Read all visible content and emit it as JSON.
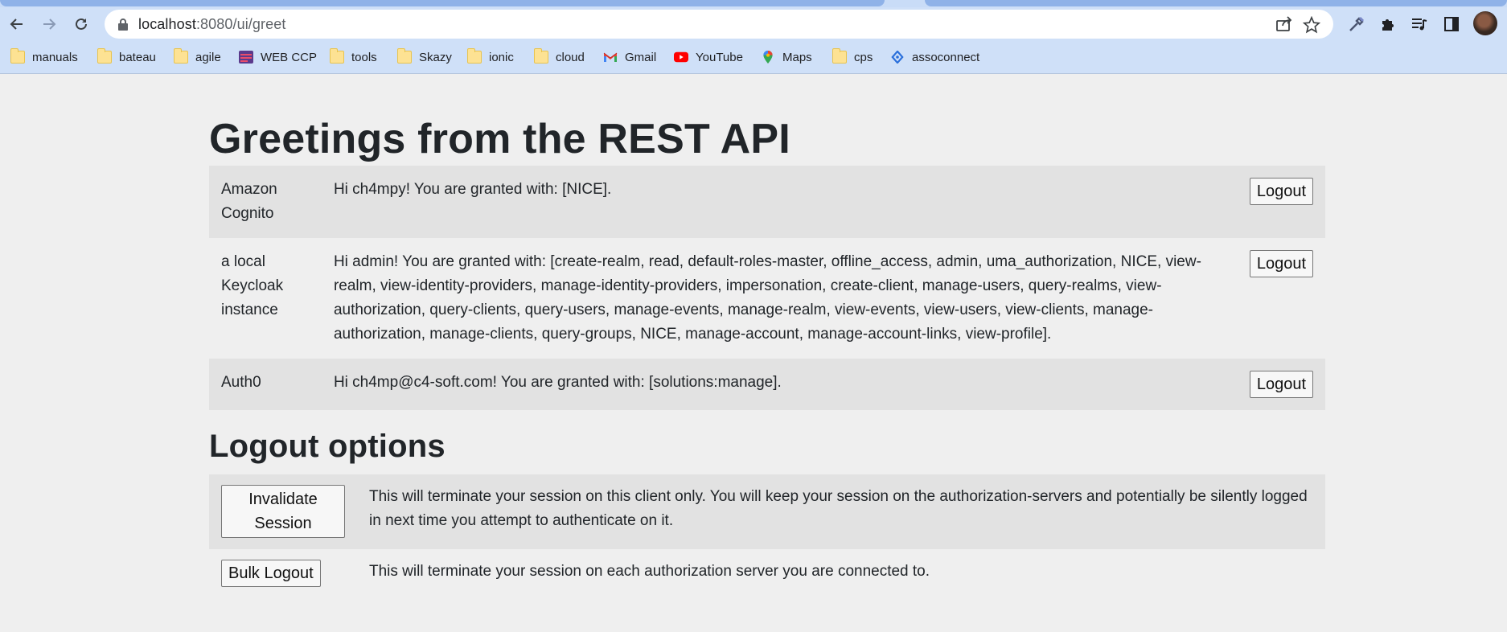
{
  "browser": {
    "url_host": "localhost",
    "url_rest": ":8080/ui/greet",
    "bookmarks": [
      {
        "label": "manuals",
        "icon": "folder-icon"
      },
      {
        "label": "bateau",
        "icon": "folder-icon"
      },
      {
        "label": "agile",
        "icon": "folder-icon"
      },
      {
        "label": "WEB CCP",
        "icon": "webccp-icon"
      },
      {
        "label": "tools",
        "icon": "folder-icon"
      },
      {
        "label": "Skazy",
        "icon": "folder-icon"
      },
      {
        "label": "ionic",
        "icon": "folder-icon"
      },
      {
        "label": "cloud",
        "icon": "folder-icon"
      },
      {
        "label": "Gmail",
        "icon": "gmail-icon"
      },
      {
        "label": "YouTube",
        "icon": "youtube-icon"
      },
      {
        "label": "Maps",
        "icon": "maps-icon"
      },
      {
        "label": "cps",
        "icon": "folder-icon"
      },
      {
        "label": "assoconnect",
        "icon": "assoconnect-icon"
      }
    ]
  },
  "main": {
    "title": "Greetings from the REST API",
    "greetings": [
      {
        "provider": "Amazon Cognito",
        "message": "Hi ch4mpy! You are granted with: [NICE].",
        "logout_label": "Logout"
      },
      {
        "provider": "a local Keycloak instance",
        "message": "Hi admin! You are granted with: [create-realm, read, default-roles-master, offline_access, admin, uma_authorization, NICE, view-realm, view-identity-providers, manage-identity-providers, impersonation, create-client, manage-users, query-realms, view-authorization, query-clients, query-users, manage-events, manage-realm, view-events, view-users, view-clients, manage-authorization, manage-clients, query-groups, NICE, manage-account, manage-account-links, view-profile].",
        "logout_label": "Logout"
      },
      {
        "provider": "Auth0",
        "message": "Hi ch4mp@c4-soft.com! You are granted with: [solutions:manage].",
        "logout_label": "Logout"
      }
    ],
    "logout_options_title": "Logout options",
    "logout_options": [
      {
        "button": "Invalidate Session",
        "description": "This will terminate your session on this client only. You will keep your session on the authorization-servers and potentially be silently logged in next time you attempt to authenticate on it."
      },
      {
        "button": "Bulk Logout",
        "description": "This will terminate your session on each authorization server you are connected to."
      }
    ]
  }
}
